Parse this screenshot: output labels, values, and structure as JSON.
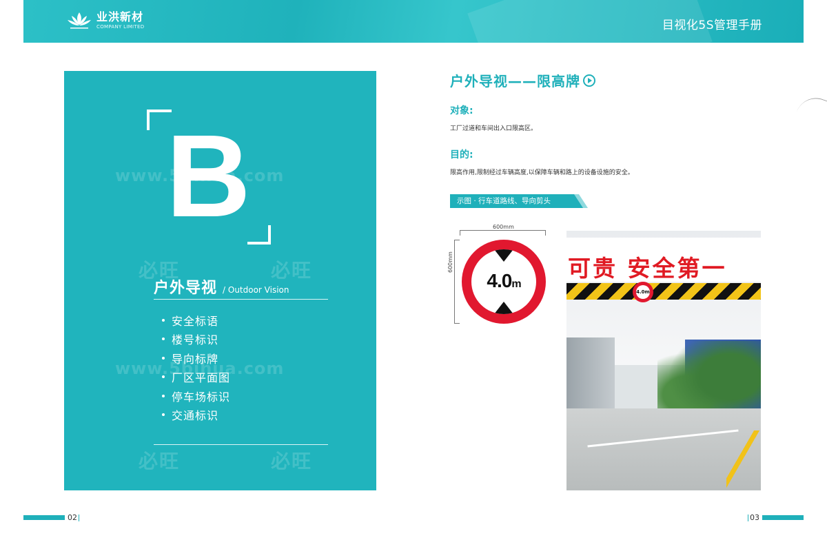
{
  "header": {
    "logo_cn": "业洪新材",
    "logo_en": "COMPANY LIMITED",
    "manual_title": "目视化5S管理手册"
  },
  "left_panel": {
    "big_letter": "B",
    "section_cn": "户外导视",
    "section_en": "/ Outdoor Vision",
    "items": [
      "安全标语",
      "楼号标识",
      "导向标牌",
      "厂区平面图",
      "停车场标识",
      "交通标识"
    ],
    "watermark_url": "www.5bihua.com",
    "watermark_logo": "必旺"
  },
  "right": {
    "title": "户外导视——限高牌",
    "object_label": "对象:",
    "object_text": "工厂过道和车间出入口限高区。",
    "purpose_label": "目的:",
    "purpose_text": "限高作用,限制经过车辆高度,以保障车辆和路上的设备设施的安全。",
    "ribbon": "示图 · 行车道路线、导向剪头",
    "sign": {
      "width_label": "600mm",
      "height_label": "600mm",
      "value": "4.0",
      "unit": "m"
    },
    "photo": {
      "banner_text": "可贵  安全第一",
      "mini_sign_text": "4.0m"
    }
  },
  "footer": {
    "page_left": "02",
    "page_right": "03"
  },
  "colors": {
    "teal": "#1fb0ba",
    "sign_red": "#e1182f"
  }
}
